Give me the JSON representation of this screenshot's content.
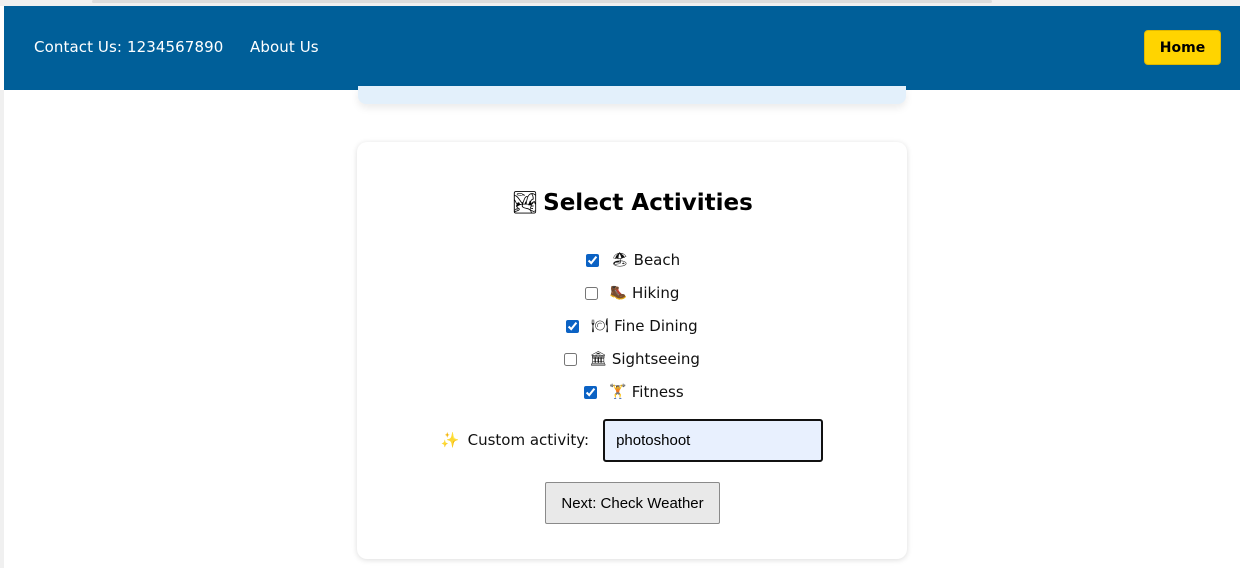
{
  "header": {
    "contact_label": "Contact Us: 1234567890",
    "about_label": "About Us",
    "home_label": "Home",
    "bg_color": "#005f99",
    "home_color": "#ffd400"
  },
  "activities_card": {
    "title_icon": "🏞",
    "title": "Select Activities",
    "items": [
      {
        "icon": "🏖",
        "label": "Beach",
        "checked": true
      },
      {
        "icon": "🥾",
        "label": "Hiking",
        "checked": false
      },
      {
        "icon": "🍽",
        "label": "Fine Dining",
        "checked": true
      },
      {
        "icon": "🏛",
        "label": "Sightseeing",
        "checked": false
      },
      {
        "icon": "🏋",
        "label": "Fitness",
        "checked": true
      }
    ],
    "custom_icon": "✨",
    "custom_label": "Custom activity:",
    "custom_value": "photoshoot",
    "next_label": "Next: Check Weather"
  }
}
